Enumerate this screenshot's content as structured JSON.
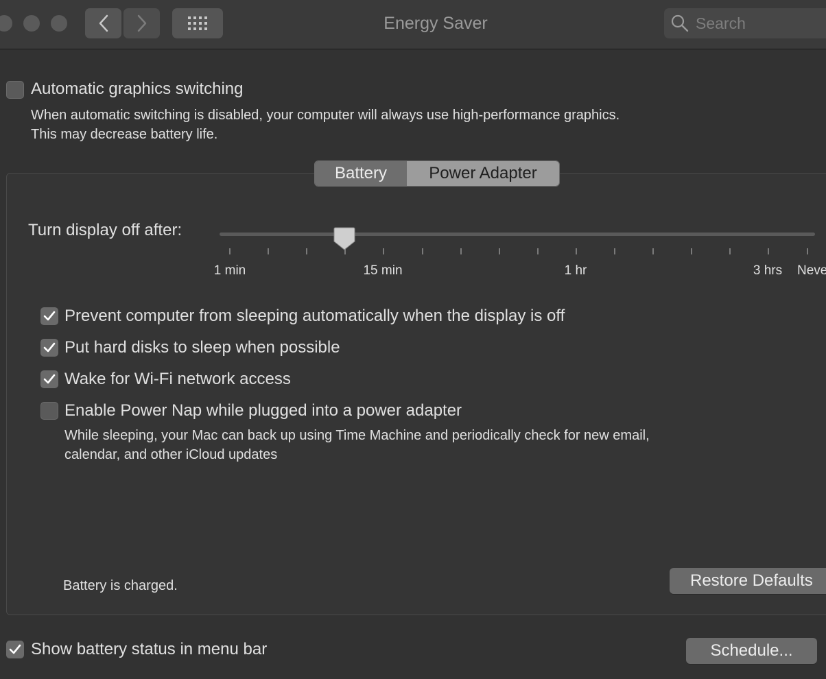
{
  "window": {
    "title": "Energy Saver"
  },
  "search": {
    "placeholder": "Search"
  },
  "graphics": {
    "label": "Automatic graphics switching",
    "checked": false,
    "desc_line1": "When automatic switching is disabled, your computer will always use high-performance graphics.",
    "desc_line2": "This may decrease battery life."
  },
  "tabs": [
    {
      "label": "Battery",
      "selected": true
    },
    {
      "label": "Power Adapter",
      "selected": false
    }
  ],
  "display_slider": {
    "label": "Turn display off after:",
    "value": "10 min",
    "tick_labels": [
      "1 min",
      "15 min",
      "1 hr",
      "3 hrs",
      "Never"
    ]
  },
  "options": [
    {
      "label": "Prevent computer from sleeping automatically when the display is off",
      "checked": true
    },
    {
      "label": "Put hard disks to sleep when possible",
      "checked": true
    },
    {
      "label": "Wake for Wi-Fi network access",
      "checked": true
    },
    {
      "label": "Enable Power Nap while plugged into a power adapter",
      "checked": false
    }
  ],
  "power_nap_desc": {
    "line1": "While sleeping, your Mac can back up using Time Machine and periodically check for new email,",
    "line2": "calendar, and other iCloud updates"
  },
  "status_text": "Battery is charged.",
  "restore_label": "Restore Defaults",
  "show_battery": {
    "label": "Show battery status in menu bar",
    "checked": true
  },
  "schedule_label": "Schedule..."
}
